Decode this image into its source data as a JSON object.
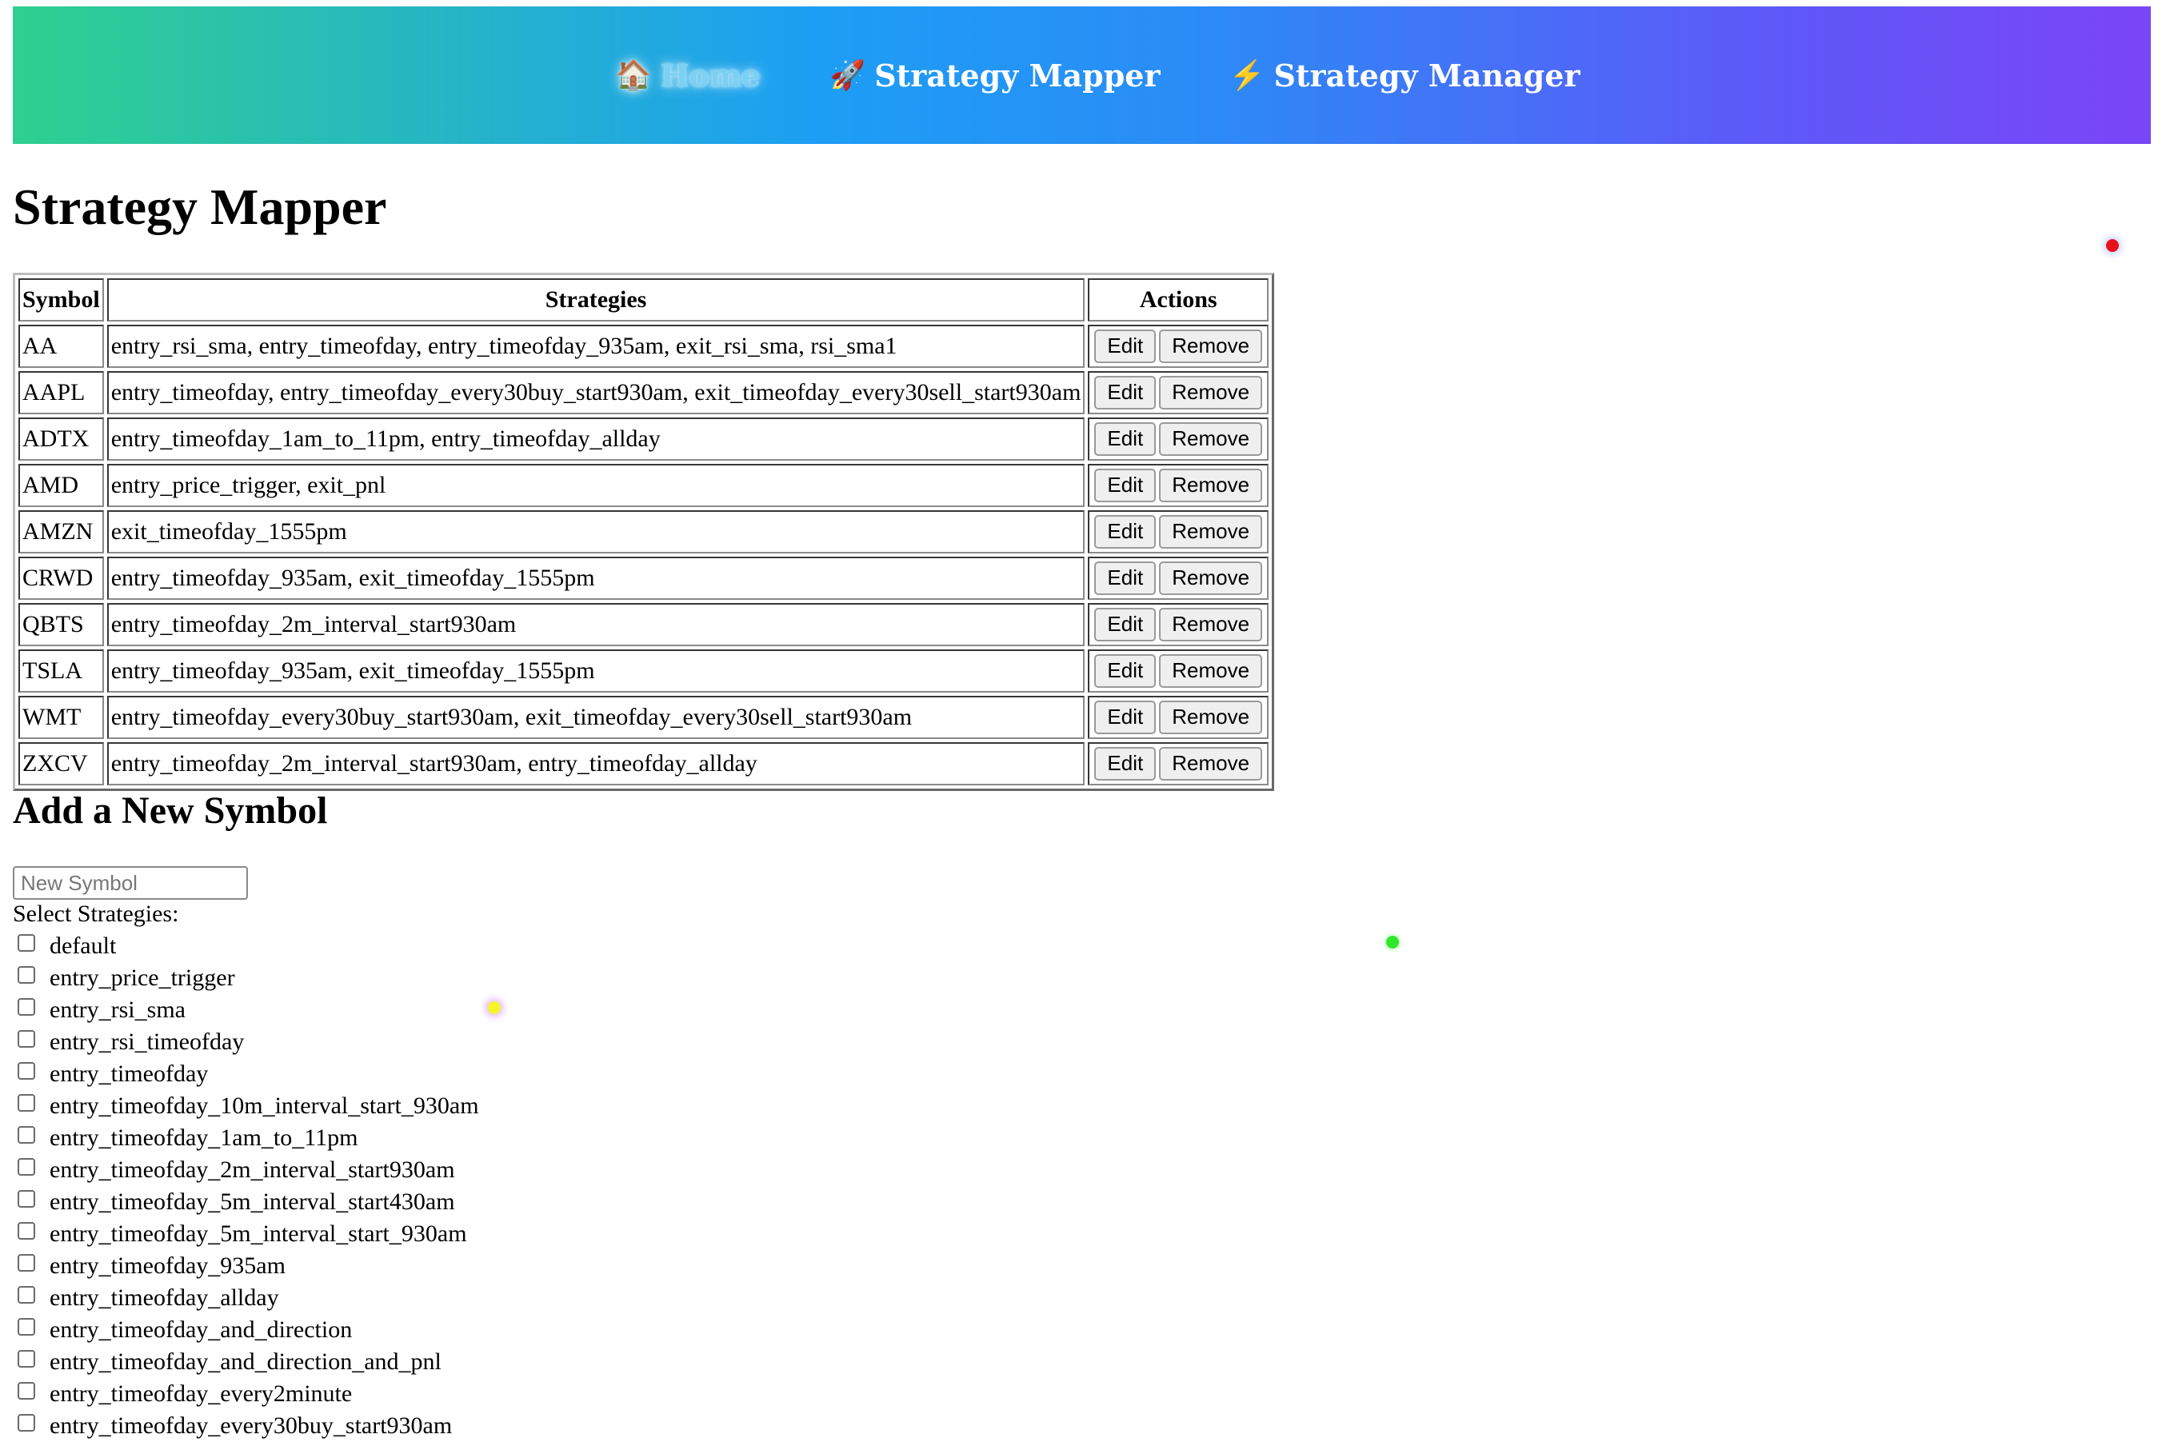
{
  "nav": {
    "items": [
      {
        "icon": "🏠",
        "label": "Home",
        "active": true
      },
      {
        "icon": "🚀",
        "label": "Strategy Mapper",
        "active": false
      },
      {
        "icon": "⚡",
        "label": "Strategy Manager",
        "active": false
      }
    ]
  },
  "page_title": "Strategy Mapper",
  "table": {
    "headers": {
      "symbol": "Symbol",
      "strategies": "Strategies",
      "actions": "Actions"
    },
    "edit_label": "Edit",
    "remove_label": "Remove",
    "rows": [
      {
        "symbol": "AA",
        "strategies": "entry_rsi_sma, entry_timeofday, entry_timeofday_935am, exit_rsi_sma, rsi_sma1"
      },
      {
        "symbol": "AAPL",
        "strategies": "entry_timeofday, entry_timeofday_every30buy_start930am, exit_timeofday_every30sell_start930am"
      },
      {
        "symbol": "ADTX",
        "strategies": "entry_timeofday_1am_to_11pm, entry_timeofday_allday"
      },
      {
        "symbol": "AMD",
        "strategies": "entry_price_trigger, exit_pnl"
      },
      {
        "symbol": "AMZN",
        "strategies": "exit_timeofday_1555pm"
      },
      {
        "symbol": "CRWD",
        "strategies": "entry_timeofday_935am, exit_timeofday_1555pm"
      },
      {
        "symbol": "QBTS",
        "strategies": "entry_timeofday_2m_interval_start930am"
      },
      {
        "symbol": "TSLA",
        "strategies": "entry_timeofday_935am, exit_timeofday_1555pm"
      },
      {
        "symbol": "WMT",
        "strategies": "entry_timeofday_every30buy_start930am, exit_timeofday_every30sell_start930am"
      },
      {
        "symbol": "ZXCV",
        "strategies": "entry_timeofday_2m_interval_start930am, entry_timeofday_allday"
      }
    ]
  },
  "add_section": {
    "title": "Add a New Symbol",
    "input_placeholder": "New Symbol",
    "input_value": "",
    "select_label": "Select Strategies:",
    "strategies": [
      {
        "label": "default",
        "checked": false
      },
      {
        "label": "entry_price_trigger",
        "checked": false
      },
      {
        "label": "entry_rsi_sma",
        "checked": false
      },
      {
        "label": "entry_rsi_timeofday",
        "checked": false
      },
      {
        "label": "entry_timeofday",
        "checked": false
      },
      {
        "label": "entry_timeofday_10m_interval_start_930am",
        "checked": false
      },
      {
        "label": "entry_timeofday_1am_to_11pm",
        "checked": false
      },
      {
        "label": "entry_timeofday_2m_interval_start930am",
        "checked": false
      },
      {
        "label": "entry_timeofday_5m_interval_start430am",
        "checked": false
      },
      {
        "label": "entry_timeofday_5m_interval_start_930am",
        "checked": false
      },
      {
        "label": "entry_timeofday_935am",
        "checked": false
      },
      {
        "label": "entry_timeofday_allday",
        "checked": false
      },
      {
        "label": "entry_timeofday_and_direction",
        "checked": false
      },
      {
        "label": "entry_timeofday_and_direction_and_pnl",
        "checked": false
      },
      {
        "label": "entry_timeofday_every2minute",
        "checked": false
      },
      {
        "label": "entry_timeofday_every30buy_start930am",
        "checked": false
      }
    ]
  },
  "colors": {
    "nav_gradient_start": "#2fd08f",
    "nav_gradient_end": "#7b45f5",
    "active_nav": "#7fd4f4",
    "dot_red": "#e8121c",
    "dot_green": "#2fe82a",
    "dot_yellow": "#f5f52a"
  }
}
